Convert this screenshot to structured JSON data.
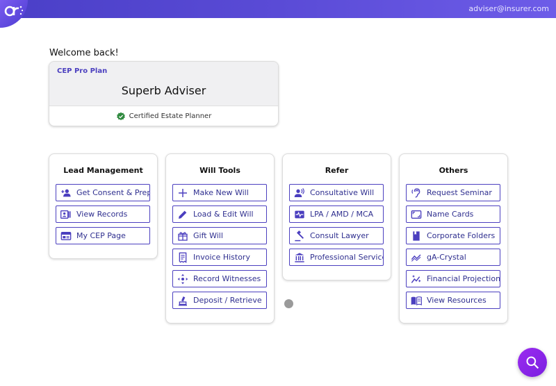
{
  "header": {
    "user_email": "adviser@insurer.com",
    "logo_icon": "brand-logo-icon"
  },
  "welcome_text": "Welcome back!",
  "plan_card": {
    "plan_name": "CEP Pro Plan",
    "adviser_name": "Superb Adviser",
    "certification": "Certified Estate Planner",
    "cert_icon": "verified-badge-icon"
  },
  "sections": [
    {
      "title": "Lead Management",
      "items": [
        {
          "label": "Get Consent & Prep.",
          "icon": "add-person-icon"
        },
        {
          "label": "View Records",
          "icon": "id-card-icon"
        },
        {
          "label": "My CEP Page",
          "icon": "web-page-icon"
        }
      ]
    },
    {
      "title": "Will Tools",
      "items": [
        {
          "label": "Make New Will",
          "icon": "plus-icon"
        },
        {
          "label": "Load & Edit Will",
          "icon": "pencil-icon"
        },
        {
          "label": "Gift Will",
          "icon": "gift-icon"
        },
        {
          "label": "Invoice History",
          "icon": "receipt-icon"
        },
        {
          "label": "Record Witnesses",
          "icon": "move-arrows-icon"
        },
        {
          "label": "Deposit / Retrieve",
          "icon": "vault-icon"
        }
      ]
    },
    {
      "title": "Refer",
      "items": [
        {
          "label": "Consultative Will",
          "icon": "speaking-person-icon"
        },
        {
          "label": "LPA / AMD / MCA",
          "icon": "health-monitor-icon"
        },
        {
          "label": "Consult Lawyer",
          "icon": "gavel-icon"
        },
        {
          "label": "Professional Services",
          "icon": "bank-icon"
        }
      ]
    },
    {
      "title": "Others",
      "items": [
        {
          "label": "Request Seminar",
          "icon": "hearing-icon"
        },
        {
          "label": "Name Cards",
          "icon": "card-frame-icon"
        },
        {
          "label": "Corporate Folders",
          "icon": "folder-book-icon"
        },
        {
          "label": "gA-Crystal",
          "icon": "trend-icon"
        },
        {
          "label": "Financial Projections",
          "icon": "sparkle-chart-icon"
        },
        {
          "label": "View Resources",
          "icon": "open-book-icon"
        }
      ]
    }
  ],
  "fab_icon": "search-icon",
  "colors": {
    "header_start": "#4a3fc7",
    "header_end": "#6d5ce8",
    "accent": "#4b3fbf",
    "button_text": "#2f2f8f",
    "fab": "#8a24e8"
  }
}
